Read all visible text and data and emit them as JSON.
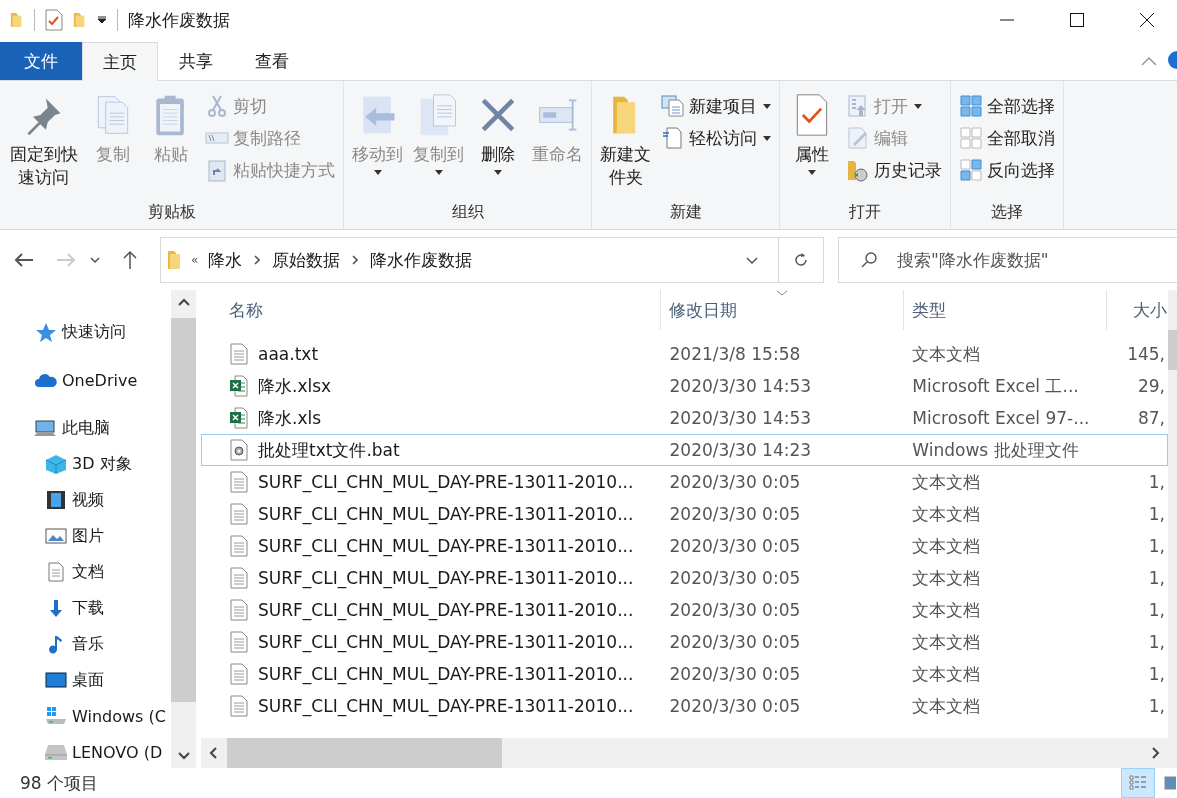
{
  "window": {
    "title": "降水作废数据"
  },
  "ribbon_tabs": [
    {
      "label": "文件",
      "kind": "file",
      "selected": false
    },
    {
      "label": "主页",
      "kind": "tab",
      "selected": true
    },
    {
      "label": "共享",
      "kind": "tab",
      "selected": false
    },
    {
      "label": "查看",
      "kind": "tab",
      "selected": false
    }
  ],
  "ribbon": [
    {
      "label": "剪贴板",
      "large": [
        {
          "label": "固定到快速访问",
          "disabled": false,
          "dropdown": false
        },
        {
          "label": "复制",
          "disabled": true,
          "dropdown": false
        },
        {
          "label": "粘贴",
          "disabled": true,
          "dropdown": false
        }
      ],
      "small": [
        {
          "label": "剪切",
          "disabled": true,
          "dropdown": false
        },
        {
          "label": "复制路径",
          "disabled": true,
          "dropdown": false
        },
        {
          "label": "粘贴快捷方式",
          "disabled": true,
          "dropdown": false
        }
      ]
    },
    {
      "label": "组织",
      "large": [
        {
          "label": "移动到",
          "disabled": true,
          "dropdown": true
        },
        {
          "label": "复制到",
          "disabled": true,
          "dropdown": true
        },
        {
          "label": "删除",
          "disabled": false,
          "dropdown": true
        },
        {
          "label": "重命名",
          "disabled": true,
          "dropdown": false
        }
      ]
    },
    {
      "label": "新建",
      "large": [
        {
          "label": "新建文件夹",
          "disabled": false,
          "dropdown": false
        }
      ],
      "small": [
        {
          "label": "新建项目",
          "disabled": false,
          "dropdown": true
        },
        {
          "label": "轻松访问",
          "disabled": false,
          "dropdown": true
        }
      ]
    },
    {
      "label": "打开",
      "large": [
        {
          "label": "属性",
          "disabled": false,
          "dropdown": true
        }
      ],
      "small": [
        {
          "label": "打开",
          "disabled": true,
          "dropdown": true
        },
        {
          "label": "编辑",
          "disabled": true,
          "dropdown": false
        },
        {
          "label": "历史记录",
          "disabled": false,
          "dropdown": false
        }
      ]
    },
    {
      "label": "选择",
      "small": [
        {
          "label": "全部选择",
          "disabled": false,
          "dropdown": false
        },
        {
          "label": "全部取消",
          "disabled": false,
          "dropdown": false
        },
        {
          "label": "反向选择",
          "disabled": false,
          "dropdown": false
        }
      ]
    }
  ],
  "address": {
    "overflow": "«",
    "path": [
      "降水",
      "原始数据",
      "降水作废数据"
    ]
  },
  "search": {
    "placeholder": "搜索\"降水作废数据\""
  },
  "sidebar": {
    "items": [
      {
        "label": "快速访问"
      },
      {
        "label": "OneDrive"
      },
      {
        "label": "此电脑",
        "children": [
          {
            "label": "3D 对象"
          },
          {
            "label": "视频"
          },
          {
            "label": "图片"
          },
          {
            "label": "文档"
          },
          {
            "label": "下载"
          },
          {
            "label": "音乐"
          },
          {
            "label": "桌面"
          },
          {
            "label": "Windows (C"
          },
          {
            "label": "LENOVO (D"
          }
        ]
      }
    ]
  },
  "table": {
    "columns": [
      "名称",
      "修改日期",
      "类型",
      "大小"
    ],
    "rows": [
      {
        "kind": "text",
        "name": "aaa.txt",
        "date": "2021/3/8 15:58",
        "type": "文本文档",
        "size": "145,",
        "selected": false
      },
      {
        "kind": "xlsx",
        "name": "降水.xlsx",
        "date": "2020/3/30 14:53",
        "type": "Microsoft Excel 工...",
        "size": "29,",
        "selected": false
      },
      {
        "kind": "xls",
        "name": "降水.xls",
        "date": "2020/3/30 14:53",
        "type": "Microsoft Excel 97-...",
        "size": "87,",
        "selected": false
      },
      {
        "kind": "bat",
        "name": "批处理txt文件.bat",
        "date": "2020/3/30 14:23",
        "type": "Windows 批处理文件",
        "size": "",
        "selected": true
      },
      {
        "kind": "text",
        "name": "SURF_CLI_CHN_MUL_DAY-PRE-13011-2010...",
        "date": "2020/3/30 0:05",
        "type": "文本文档",
        "size": "1,",
        "selected": false
      },
      {
        "kind": "text",
        "name": "SURF_CLI_CHN_MUL_DAY-PRE-13011-2010...",
        "date": "2020/3/30 0:05",
        "type": "文本文档",
        "size": "1,",
        "selected": false
      },
      {
        "kind": "text",
        "name": "SURF_CLI_CHN_MUL_DAY-PRE-13011-2010...",
        "date": "2020/3/30 0:05",
        "type": "文本文档",
        "size": "1,",
        "selected": false
      },
      {
        "kind": "text",
        "name": "SURF_CLI_CHN_MUL_DAY-PRE-13011-2010...",
        "date": "2020/3/30 0:05",
        "type": "文本文档",
        "size": "1,",
        "selected": false
      },
      {
        "kind": "text",
        "name": "SURF_CLI_CHN_MUL_DAY-PRE-13011-2010...",
        "date": "2020/3/30 0:05",
        "type": "文本文档",
        "size": "1,",
        "selected": false
      },
      {
        "kind": "text",
        "name": "SURF_CLI_CHN_MUL_DAY-PRE-13011-2010...",
        "date": "2020/3/30 0:05",
        "type": "文本文档",
        "size": "1,",
        "selected": false
      },
      {
        "kind": "text",
        "name": "SURF_CLI_CHN_MUL_DAY-PRE-13011-2010...",
        "date": "2020/3/30 0:05",
        "type": "文本文档",
        "size": "1,",
        "selected": false
      },
      {
        "kind": "text",
        "name": "SURF_CLI_CHN_MUL_DAY-PRE-13011-2010...",
        "date": "2020/3/30 0:05",
        "type": "文本文档",
        "size": "1,",
        "selected": false
      }
    ]
  },
  "status_bar": {
    "count": "98 个项目"
  }
}
